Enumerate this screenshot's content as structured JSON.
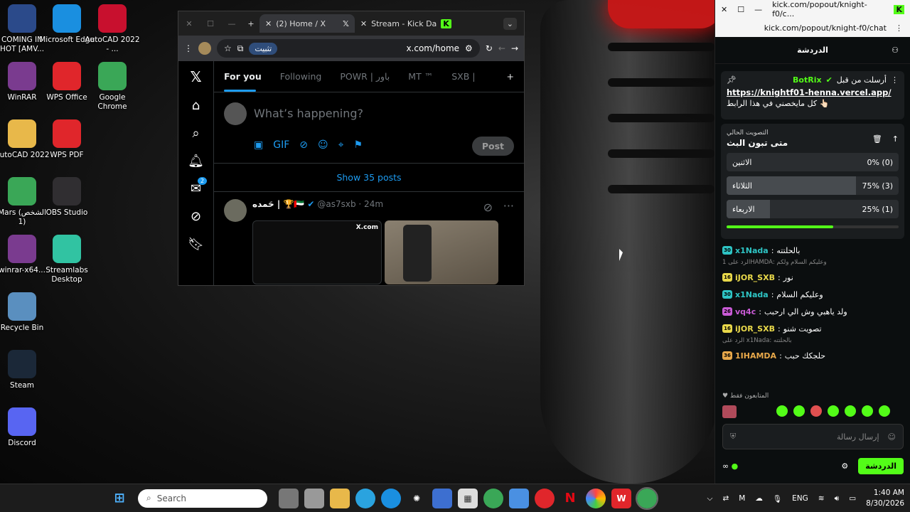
{
  "desktop": {
    "icons": [
      {
        "label": "COMING IN HOT [AMV...",
        "icon": "video-file-icon",
        "color": "#2b4a8a"
      },
      {
        "label": "Microsoft Edge",
        "icon": "edge-icon",
        "color": "#1a8fe0"
      },
      {
        "label": "AutoCAD 2022 - ...",
        "icon": "autocad-icon",
        "color": "#c8102e"
      },
      {
        "label": "WinRAR",
        "icon": "winrar-icon",
        "color": "#7a3b8f"
      },
      {
        "label": "WPS Office",
        "icon": "wps-office-icon",
        "color": "#e0262b"
      },
      {
        "label": "Google Chrome",
        "icon": "chrome-icon",
        "color": "#3aa757"
      },
      {
        "label": "AutoCAD 2022",
        "icon": "folder-icon",
        "color": "#e8b84a"
      },
      {
        "label": "WPS PDF",
        "icon": "wps-pdf-icon",
        "color": "#e0262b"
      },
      {
        "label": "Mars (الشخص 1)",
        "icon": "chrome-icon",
        "color": "#3aa757"
      },
      {
        "label": "OBS Studio",
        "icon": "obs-icon",
        "color": "#302e31"
      },
      {
        "label": "winrar-x64...",
        "icon": "winrar-icon",
        "color": "#7a3b8f"
      },
      {
        "label": "Streamlabs Desktop",
        "icon": "streamlabs-icon",
        "color": "#31c3a2"
      },
      {
        "label": "Recycle Bin",
        "icon": "recycle-bin-icon",
        "color": "#5a8fbf"
      },
      {
        "label": "Steam",
        "icon": "steam-icon",
        "color": "#1b2838"
      },
      {
        "label": "Discord",
        "icon": "discord-icon",
        "color": "#5865f2"
      }
    ]
  },
  "browser": {
    "tabs": [
      {
        "label": "(2) Home / X",
        "active": true
      },
      {
        "label": "Stream - Kick Da",
        "active": false
      }
    ],
    "translate_label": "تثبيت",
    "url": "x.com/home"
  },
  "x": {
    "tabs": [
      "For you",
      "Following",
      "POWR | باور",
      "MT ™",
      "SXB |"
    ],
    "compose_placeholder": "What’s happening?",
    "post_button": "Post",
    "show_posts": "Show 35 posts",
    "notif_badge": "2",
    "tweet": {
      "name": "حَمده | 🏆🇦🇪",
      "handle": "@as7sxb · 24m",
      "media_text": "X.com"
    }
  },
  "kick": {
    "window_title": "kick.com/popout/knight-f0/c...",
    "url": "kick.com/popout/knight-f0/chat",
    "chat_title": "الدردشة",
    "pinned": {
      "bot": "BotRix",
      "sent_by": "أرسلت من قبل",
      "link": "https://knightf01-henna.vercel.app/",
      "text": "كل مايخصني في هذا الرابط 👆🏻"
    },
    "poll": {
      "label": "التصويت الحالي",
      "question": "متى تبون البث",
      "options": [
        {
          "name": "الاثنين",
          "result": "0% (0)",
          "fraction": 0.0
        },
        {
          "name": "الثلاثاء",
          "result": "75% (3)",
          "fraction": 0.75
        },
        {
          "name": "الاربعاء",
          "result": "25% (1)",
          "fraction": 0.25
        }
      ],
      "time_left": 0.62
    },
    "messages": [
      {
        "user": "x1Nada",
        "text": "بالحلتته",
        "badge": "30",
        "color": "#2ec4c4",
        "reply": ""
      },
      {
        "user": "iJOR_SXB",
        "text": "نور",
        "badge": "16",
        "color": "#e8d84a",
        "reply": "الرد على 1HAMDA: وعليكم السلام ولكم"
      },
      {
        "user": "x1Nada",
        "text": "وعليكم السلام",
        "badge": "30",
        "color": "#2ec4c4",
        "reply": ""
      },
      {
        "user": "vq4c",
        "text": "ولد ياهبي وش الي ارحبب",
        "badge": "26",
        "color": "#c95bd6",
        "reply": ""
      },
      {
        "user": "iJOR_SXB",
        "text": "تصويت شنو",
        "badge": "16",
        "color": "#e8d84a",
        "reply": ""
      },
      {
        "user": "1IHAMDA",
        "text": "حلجكك حبب",
        "badge": "36",
        "color": "#e8a84a",
        "reply": "الرد على x1Nada: بالحلتته"
      }
    ],
    "followers_only": "المتابعون فقط",
    "input_placeholder": "إرسال رسالة",
    "send_button": "الدردشة"
  },
  "taskbar": {
    "search_placeholder": "Search",
    "lang": "ENG",
    "time": "1:40 AM",
    "date": "8/30/2026"
  }
}
